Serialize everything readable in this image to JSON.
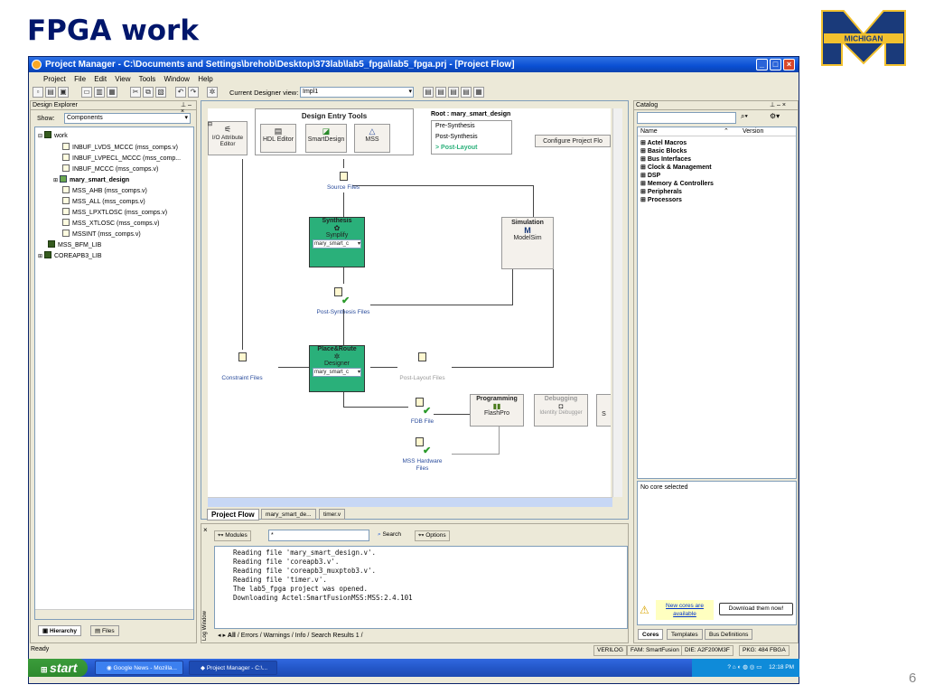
{
  "slide": {
    "title": "FPGA work",
    "page_number": "6",
    "logo_text": "MICHIGAN"
  },
  "window": {
    "title": "Project Manager - C:\\Documents and Settings\\brehob\\Desktop\\373lab\\lab5_fpga\\lab5_fpga.prj - [Project Flow]"
  },
  "menu": [
    "Project",
    "File",
    "Edit",
    "View",
    "Tools",
    "Window",
    "Help"
  ],
  "toolbar": {
    "designer_view_label": "Current Designer view:",
    "designer_view_value": "Impl1"
  },
  "design_explorer": {
    "title": "Design Explorer",
    "show_label": "Show:",
    "show_value": "Components",
    "tree": [
      "work",
      "INBUF_LVDS_MCCC (mss_comps.v)",
      "INBUF_LVPECL_MCCC (mss_comp...",
      "INBUF_MCCC (mss_comps.v)",
      "mary_smart_design",
      "MSS_AHB (mss_comps.v)",
      "MSS_ALL (mss_comps.v)",
      "MSS_LPXTLOSC (mss_comps.v)",
      "MSS_XTLOSC (mss_comps.v)",
      "MSSINT (mss_comps.v)",
      "MSS_BFM_LIB",
      "COREAPB3_LIB"
    ],
    "tabs": [
      "Hierarchy",
      "Files"
    ]
  },
  "flow": {
    "design_entry_title": "Design Entry Tools",
    "io_attr": "I/O Attribute Editor",
    "hdl_editor": "HDL Editor",
    "smartdesign": "SmartDesign",
    "mss": "MSS",
    "root_label": "Root : mary_smart_design",
    "states": [
      "Pre-Synthesis",
      "Post-Synthesis",
      "> Post-Layout"
    ],
    "configure_btn": "Configure Project Flo",
    "source_files": "Source Files",
    "synthesis_title": "Synthesis",
    "synplify": "Synplify",
    "synth_select": "mary_smart_c",
    "simulation_title": "Simulation",
    "modelsim": "ModelSim",
    "post_synth": "Post-Synthesis Files",
    "constraint": "Constraint Files",
    "pnr_title": "Place&Route",
    "designer": "Designer",
    "pnr_select": "mary_smart_c",
    "post_layout": "Post-Layout Files",
    "fdb": "FDB File",
    "programming_title": "Programming",
    "flashpro": "FlashPro",
    "debugging_title": "Debugging",
    "identity_debugger": "Identity Debugger",
    "mss_hw": "MSS Hardware Files",
    "s_label": "S"
  },
  "doc_tabs": [
    "Project Flow",
    "mary_smart_de...",
    "timer.v"
  ],
  "log_window": {
    "modules_label": "Modules",
    "search_value": "*",
    "search_btn": "Search",
    "options_btn": "Options",
    "side_label": "Log Window",
    "lines": [
      "Reading file 'mary_smart_design.v'.",
      "Reading file 'coreapb3.v'.",
      "Reading file 'coreapb3_muxptob3.v'.",
      "Reading file 'timer.v'.",
      "The lab5_fpga project was opened.",
      "Downloading Actel:SmartFusionMSS:MSS:2.4.101"
    ],
    "tabs": [
      "All",
      "Errors",
      "Warnings",
      "Info",
      "Search Results 1"
    ]
  },
  "catalog": {
    "title": "Catalog",
    "col_name": "Name",
    "col_version": "Version",
    "items": [
      "Actel Macros",
      "Basic Blocks",
      "Bus Interfaces",
      "Clock & Management",
      "DSP",
      "Memory & Controllers",
      "Peripherals",
      "Processors"
    ],
    "no_core": "No core selected",
    "new_cores": "New cores are available",
    "download_btn": "Download them now!",
    "tabs": [
      "Cores",
      "Templates",
      "Bus Definitions"
    ]
  },
  "status": {
    "ready": "Ready",
    "lang": "VERILOG",
    "fam": "FAM: SmartFusion",
    "die": "DIE: A2F200M3F",
    "pkg": "PKG: 484 FBGA"
  },
  "taskbar": {
    "start": "start",
    "tasks": [
      "Google News - Mozilla...",
      "Project Manager - C:\\..."
    ],
    "clock": "12:18 PM"
  }
}
